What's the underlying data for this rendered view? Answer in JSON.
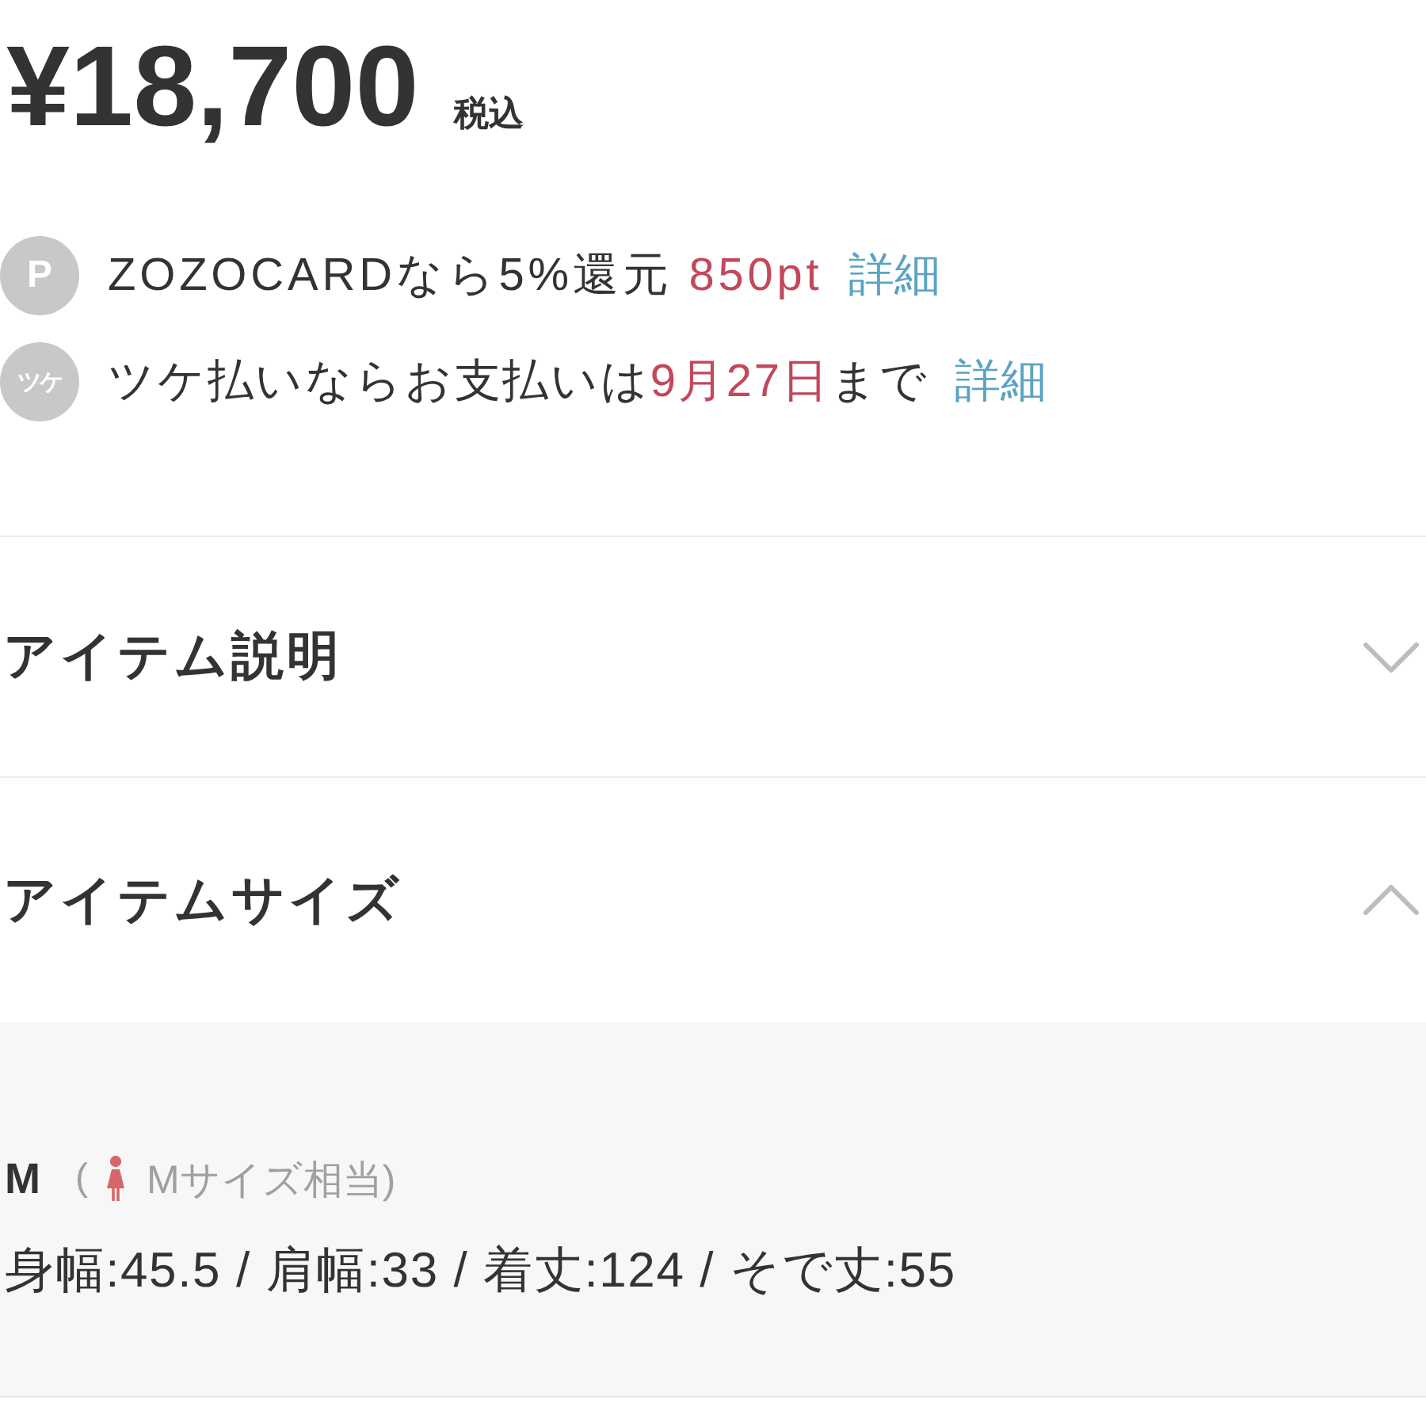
{
  "price": {
    "amount": "¥18,700",
    "tax_note": "税込"
  },
  "benefits": [
    {
      "kind": "points",
      "badge": "P",
      "segments": [
        {
          "text": "ZOZOCARDなら5%還元 ",
          "highlight": false
        },
        {
          "text": "850pt",
          "highlight": true
        }
      ],
      "link": "詳細"
    },
    {
      "kind": "deferred",
      "badge": "ツケ",
      "segments": [
        {
          "text": "ツケ払いならお支払いは",
          "highlight": false
        },
        {
          "text": "9月27日",
          "highlight": true
        },
        {
          "text": "まで",
          "highlight": false
        }
      ],
      "link": "詳細"
    }
  ],
  "sections": [
    {
      "title": "アイテム説明",
      "expanded": false
    },
    {
      "title": "アイテムサイズ",
      "expanded": true,
      "content": {
        "size": "M",
        "note_open": "(",
        "note": "Mサイズ相当)",
        "measurements": "身幅:45.5 / 肩幅:33 / 着丈:124 / そで丈:55"
      }
    }
  ]
}
